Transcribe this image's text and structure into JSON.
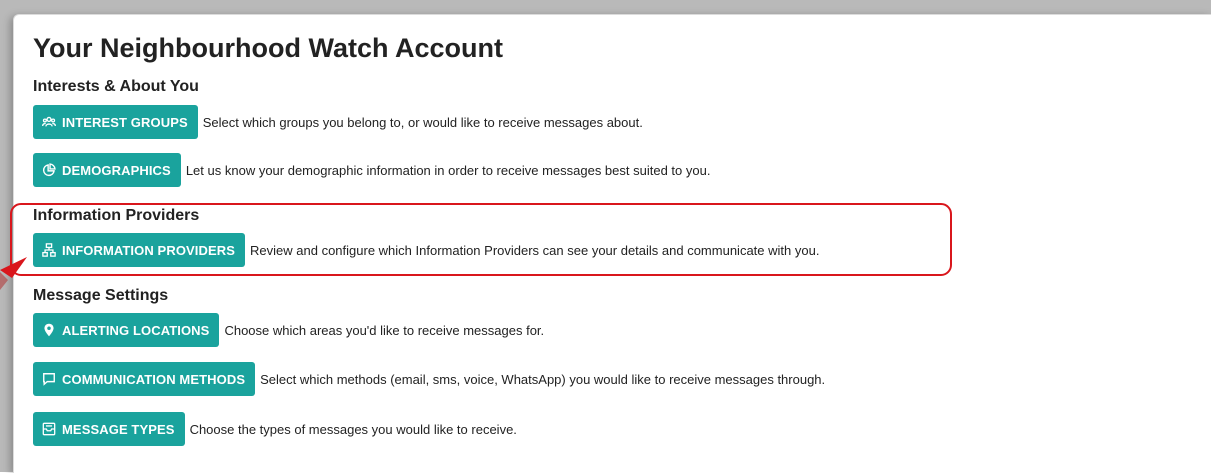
{
  "page": {
    "title": "Your Neighbourhood Watch Account"
  },
  "sections": [
    {
      "heading": "Interests & About You",
      "items": [
        {
          "icon": "users-group-icon",
          "button_label": "INTEREST GROUPS",
          "description": "Select which groups you belong to, or would like to receive messages about."
        },
        {
          "icon": "chart-pie-icon",
          "button_label": "DEMOGRAPHICS",
          "description": "Let us know your demographic information in order to receive messages best suited to you."
        }
      ]
    },
    {
      "heading": "Information Providers",
      "items": [
        {
          "icon": "sitemap-icon",
          "button_label": "INFORMATION PROVIDERS",
          "description": "Review and configure which Information Providers can see your details and communicate with you."
        }
      ]
    },
    {
      "heading": "Message Settings",
      "items": [
        {
          "icon": "map-pin-icon",
          "button_label": "ALERTING LOCATIONS",
          "description": "Choose which areas you'd like to receive messages for."
        },
        {
          "icon": "chat-bubble-icon",
          "button_label": "COMMUNICATION METHODS",
          "description": "Select which methods (email, sms, voice, WhatsApp) you would like to receive messages through."
        },
        {
          "icon": "inbox-icon",
          "button_label": "MESSAGE TYPES",
          "description": "Choose the types of messages you would like to receive."
        }
      ]
    }
  ],
  "annotation": {
    "highlight_color": "#d9161c",
    "accent_color": "#1aa39d"
  }
}
